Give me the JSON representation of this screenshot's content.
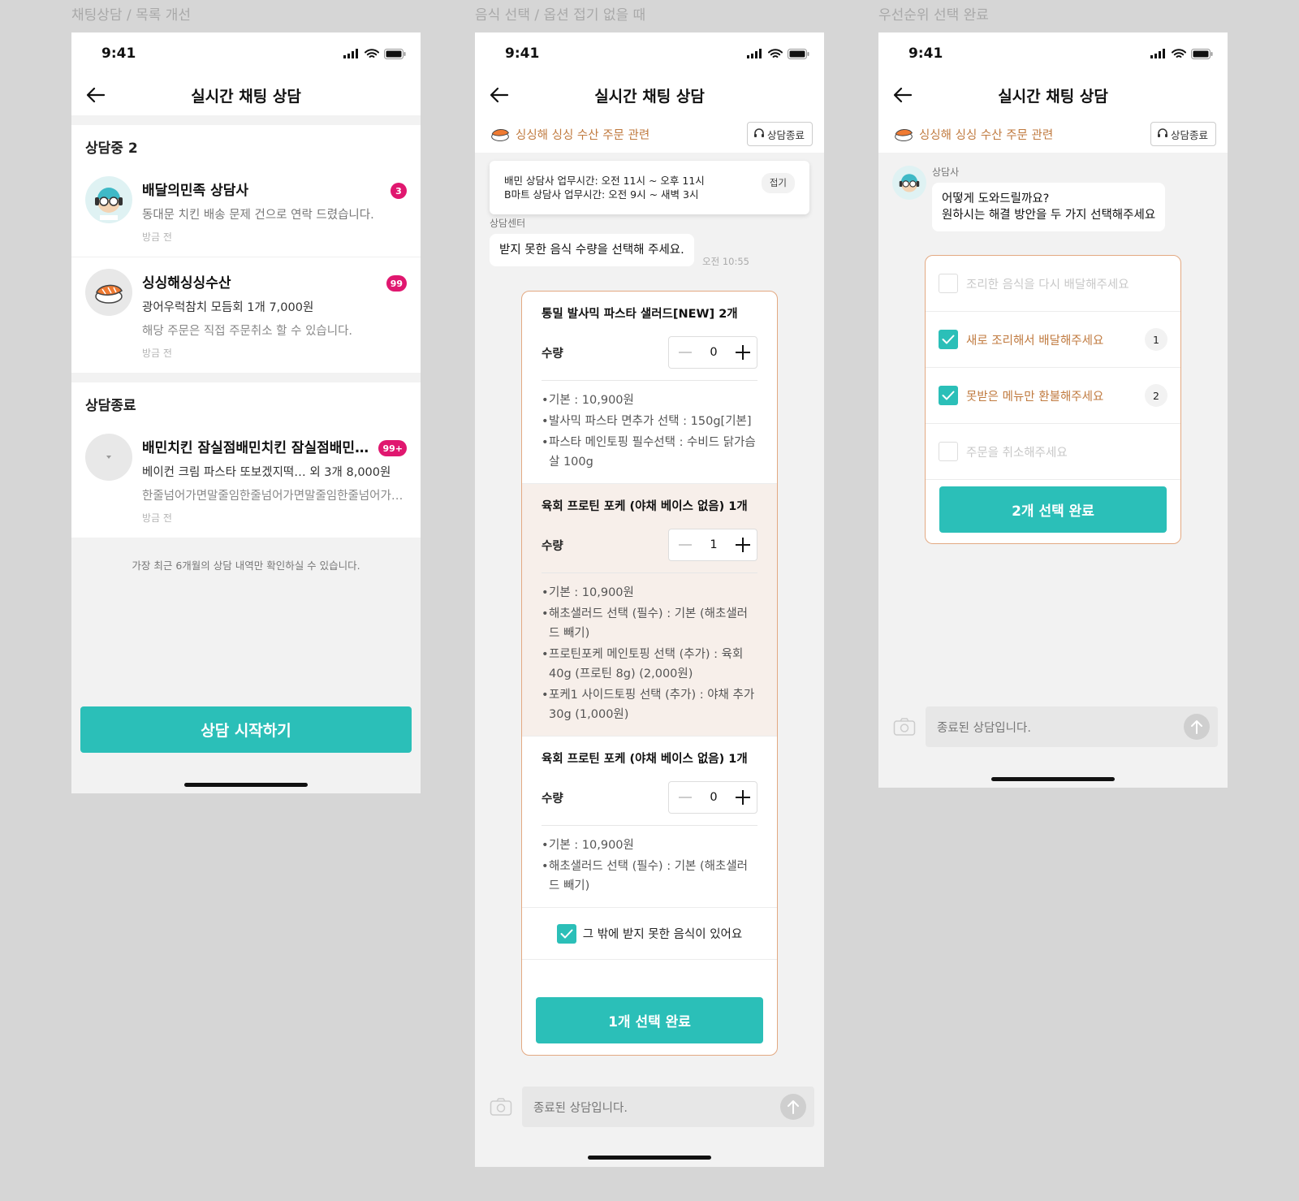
{
  "captions": [
    "채팅상담 / 목록 개선",
    "음식 선택 / 옵션 접기 없을 때",
    "우선순위 선택 완료"
  ],
  "status_time": "9:41",
  "nav_title": "실시간 채팅 상담",
  "colors": {
    "accent": "#2bbfb8",
    "badge": "#e0176f",
    "order": "#c07a3f"
  },
  "list_screen": {
    "active_header": "상담중 2",
    "active_items": [
      {
        "name": "배달의민족 상담사",
        "line1": "동대문 치킨 배송 문제 건으로 연락 드렸습니다.",
        "time": "방금 전",
        "badge": "3",
        "icon": "agent-avatar-icon"
      },
      {
        "name": "싱싱해싱싱수산",
        "line1": "광어우럭참치 모듬회 1개 7,000원",
        "line2": "해당 주문은 직접 주문취소 할 수 있습니다.",
        "time": "방금 전",
        "badge": "99",
        "icon": "sushi-icon"
      }
    ],
    "closed_header": "상담종료",
    "closed_items": [
      {
        "name": "배민치킨 잠실점배민치킨 잠실점배민치킨",
        "line1": "베이컨 크림 파스타 또보겠지떡… 외 3개 8,000원",
        "line2": "한줄넘어가면말줄임한줄넘어가면말줄임한줄넘어가면말줄임",
        "time": "방금 전",
        "badge": "99+",
        "icon": "placeholder-store-icon"
      }
    ],
    "footnote": "가장 최근 6개월의 상담 내역만 확인하실 수 있습니다.",
    "cta": "상담 시작하기"
  },
  "order_strip": {
    "text": "싱싱해 싱싱 수산 주문 관련",
    "end_button": "상담종료"
  },
  "food_screen": {
    "notice_line1": "배민 상담사 업무시간: 오전 11시 ~ 오후 11시",
    "notice_line2": "B마트 상담사 업무시간: 오전 9시 ~ 새벽 3시",
    "fold_button": "접기",
    "sender": "상담센터",
    "message": "받지 못한 음식 수량을 선택해 주세요.",
    "message_time": "오전 10:55",
    "qty_label": "수량",
    "items": [
      {
        "title": "통밀 발사믹 파스타 샐러드[NEW] 2개",
        "qty": "0",
        "options": [
          "기본 : 10,900원",
          "발사믹 파스타 면추가 선택 : 150g[기본]",
          "파스타 메인토핑 필수선택 : 수비드 닭가슴살 100g"
        ]
      },
      {
        "title": "육회 프로틴 포케 (야채 베이스 없음) 1개",
        "qty": "1",
        "options": [
          "기본 : 10,900원",
          "해초샐러드 선택 (필수) : 기본 (해초샐러드 빼기)",
          "프로틴포케 메인토핑 선택 (추가) : 육회 40g (프로틴 8g) (2,000원)",
          "포케1 사이드토핑 선택 (추가) : 야채 추가 30g (1,000원)"
        ]
      },
      {
        "title": "육회 프로틴 포케 (야채 베이스 없음) 1개",
        "qty": "0",
        "options": [
          "기본 : 10,900원",
          "해초샐러드 선택 (필수) : 기본 (해초샐러드 빼기)"
        ]
      }
    ],
    "extra_label": "그 밖에 받지 못한 음식이 있어요",
    "confirm": "1개 선택 완료",
    "composer_placeholder": "종료된 상담입니다."
  },
  "priority_screen": {
    "sender": "상담사",
    "message_line1": "어떻게 도와드릴까요?",
    "message_line2": "원하시는 해결 방안을 두 가지 선택해주세요",
    "choices": [
      {
        "label": "조리한 음식을 다시 배달해주세요",
        "rank": ""
      },
      {
        "label": "새로 조리해서 배달해주세요",
        "rank": "1"
      },
      {
        "label": "못받은 메뉴만 환불해주세요",
        "rank": "2"
      },
      {
        "label": "주문을 취소해주세요",
        "rank": ""
      }
    ],
    "confirm": "2개 선택 완료",
    "composer_placeholder": "종료된 상담입니다."
  }
}
